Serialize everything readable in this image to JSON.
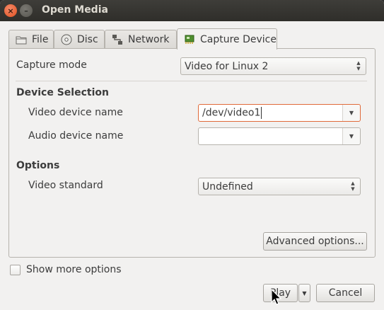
{
  "window": {
    "title": "Open Media",
    "close_glyph": "×",
    "minimize_glyph": "–"
  },
  "tabs": [
    {
      "label": "File",
      "icon": "folder-icon"
    },
    {
      "label": "Disc",
      "icon": "disc-icon"
    },
    {
      "label": "Network",
      "icon": "network-icon"
    },
    {
      "label": "Capture Device",
      "icon": "capture-card-icon",
      "active": true
    }
  ],
  "capture": {
    "mode_label": "Capture mode",
    "mode_value": "Video for Linux 2",
    "device_section": "Device Selection",
    "video_device_label": "Video device name",
    "video_device_value": "/dev/video1",
    "audio_device_label": "Audio device name",
    "audio_device_value": "",
    "options_section": "Options",
    "video_standard_label": "Video standard",
    "video_standard_value": "Undefined",
    "advanced_button": "Advanced options..."
  },
  "footer": {
    "show_more_label": "Show more options",
    "show_more_checked": false,
    "play_button": "Play",
    "cancel_button": "Cancel"
  },
  "colors": {
    "titlebar": "#3c3b37",
    "focus_accent": "#e06a3a",
    "window_bg": "#f2f1f0"
  }
}
